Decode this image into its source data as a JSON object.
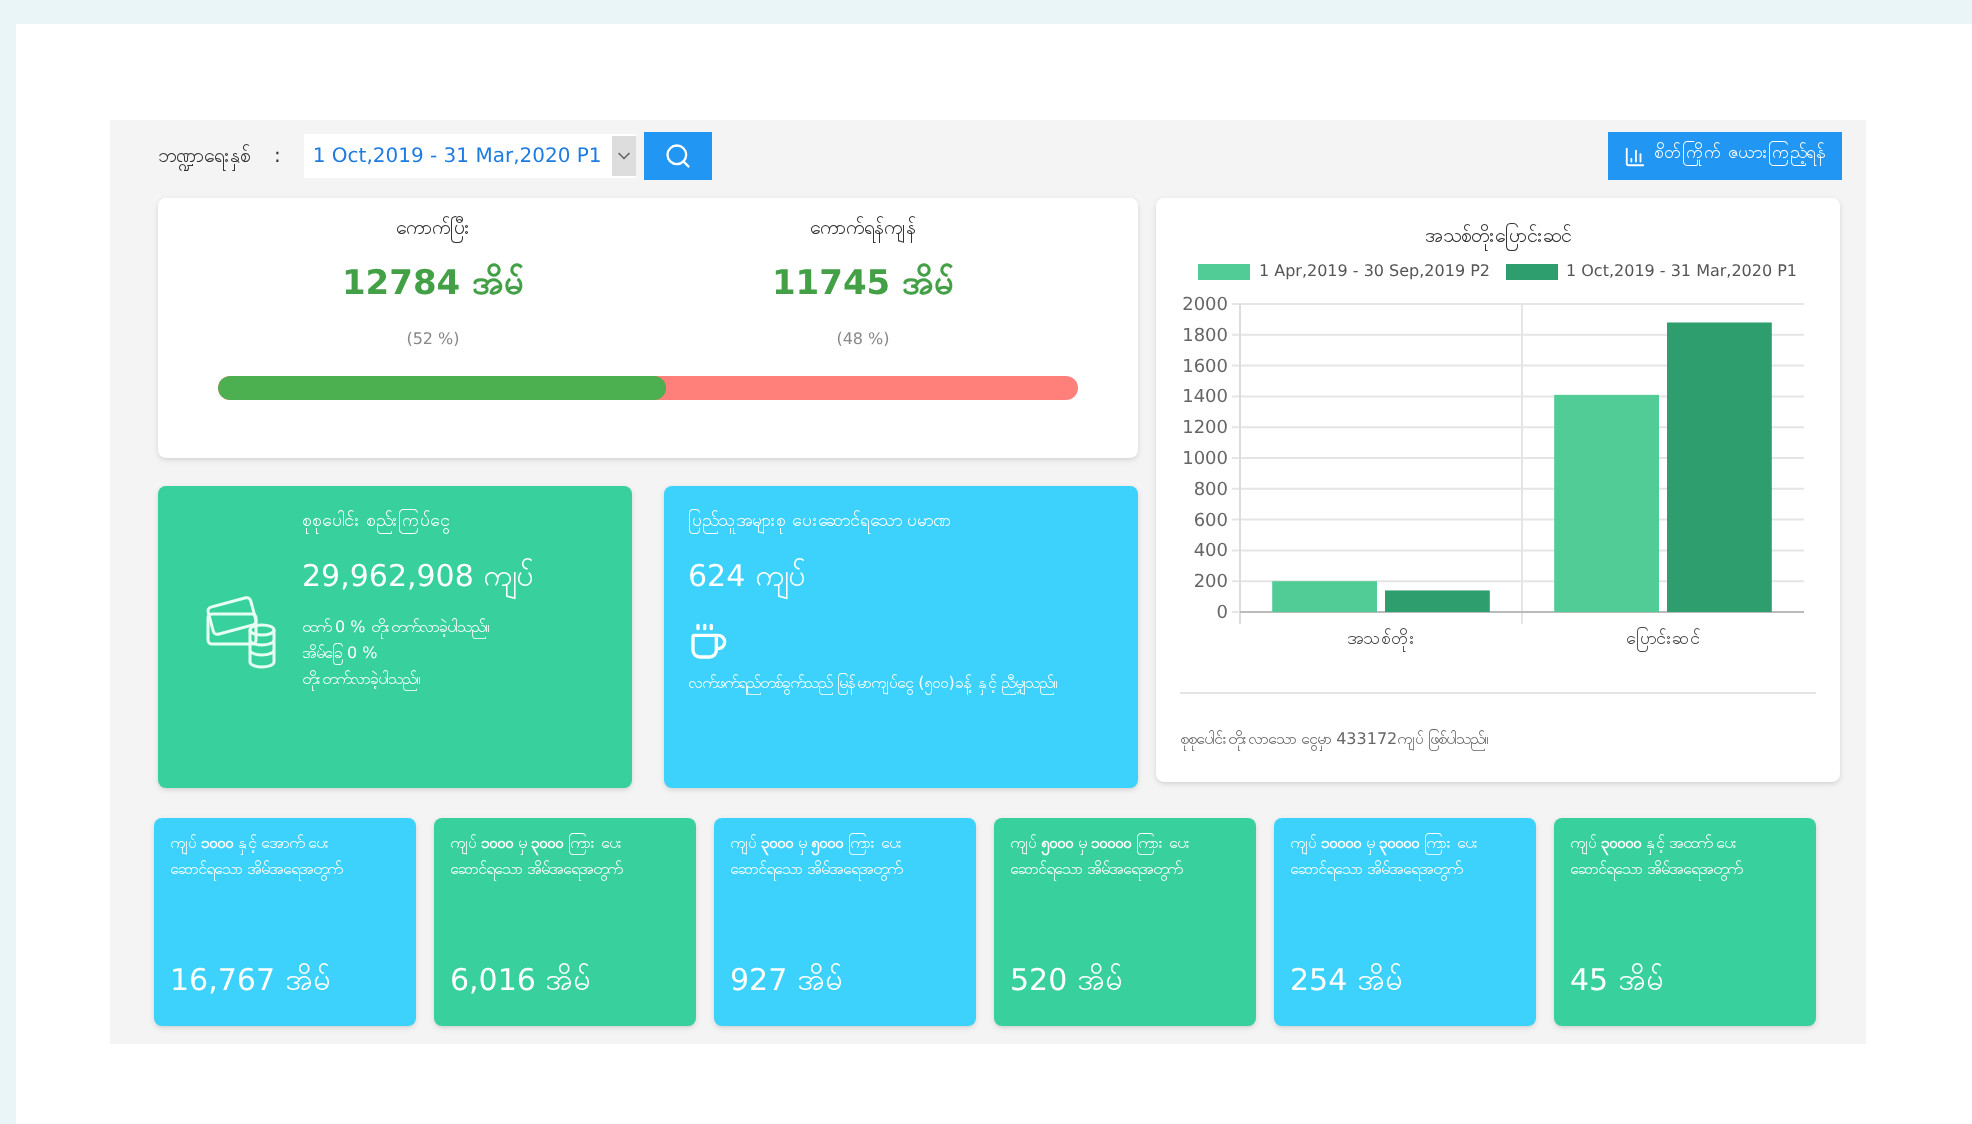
{
  "filter": {
    "label": "ဘဏ္ဍာရေးနှစ်",
    "separator": ":",
    "value": "1 Oct,2019 - 31 Mar,2020 P1"
  },
  "report_button": {
    "label": "စိတ်ကြိုက် ဇယားကြည့်ရန်"
  },
  "collection": {
    "items": [
      {
        "title": "ကောက်ပြီး",
        "value": "12784 အိမ်",
        "percent": "(52 %)"
      },
      {
        "title": "ကောက်ရန်ကျန်",
        "value": "11745 အိမ်",
        "percent": "(48 %)"
      }
    ],
    "level": 0.52
  },
  "total_card": {
    "title": "စုစုပေါင်း စည်းကြပ်ငွေ",
    "value": "29,962,908 ကျပ်",
    "lines": [
      "ထက် 0 % တိုးတက်လာခဲ့ပါသည်။",
      "အိမ်ခြေ 0 %",
      "တိုးတက်လာခဲ့ပါသည်။"
    ]
  },
  "average_card": {
    "title": "ပြည်သူအများစု ပေးဆောင်ရသော ပမာဏ",
    "value": "624 ကျပ်",
    "note": "လက်ဖက်ရည်တစ်ခွက်သည် မြန်မာကျပ်ငွေ (၅၀၀)ခန့် နှင့် ညီမျှသည်။"
  },
  "chart_card": {
    "footer": "စုစုပေါင်းတိုးလာသော ငွေမှာ 433172ကျပ် ဖြစ်ပါသည်။",
    "chart_data": {
      "type": "bar",
      "title": "အသစ်တိုးပြောင်းဆင်",
      "categories": [
        "အသစ်တိုး",
        "ပြောင်းဆင်"
      ],
      "series": [
        {
          "name": "1 Apr,2019 - 30 Sep,2019 P2",
          "color": "#52cc96",
          "values": [
            200,
            1410
          ]
        },
        {
          "name": "1 Oct,2019 - 31 Mar,2020 P1",
          "color": "#2e9e6e",
          "values": [
            140,
            1880
          ]
        }
      ],
      "grid": true,
      "legend": true,
      "ylim": [
        0,
        2000
      ],
      "yticks": [
        0,
        200,
        400,
        600,
        800,
        1000,
        1200,
        1400,
        1600,
        1800,
        2000
      ]
    }
  },
  "range_cards": [
    {
      "title": "ကျပ် **၁၀၀၀** နှင့် အောက် ပေးဆောင်ရသော အိမ်အရေအတွက်",
      "value": "16,767 အိမ်",
      "color": "#3dd2fc"
    },
    {
      "title": "ကျပ် **၁၀၀၀** မှ **၃၀၀၀** ကြား ပေးဆောင်ရသော အိမ်အရေအတွက်",
      "value": "6,016 အိမ်",
      "color": "#38d19e"
    },
    {
      "title": "ကျပ် **၃၀၀၀** မှ **၅၀၀၀** ကြား ပေးဆောင်ရသော အိမ်အရေအတွက်",
      "value": "927 အိမ်",
      "color": "#3dd2fc"
    },
    {
      "title": "ကျပ် **၅၀၀၀** မှ **၁၀၀၀၀** ကြား ပေးဆောင်ရသော အိမ်အရေအတွက်",
      "value": "520 အိမ်",
      "color": "#38d19e"
    },
    {
      "title": "ကျပ် **၁၀၀၀၀** မှ **၃၀၀၀၀** ကြား ပေးဆောင်ရသော အိမ်အရေအတွက်",
      "value": "254 အိမ်",
      "color": "#3dd2fc"
    },
    {
      "title": "ကျပ် **၃၀၀၀၀** နှင့် အထက် ပေးဆောင်ရသော အိမ်အရေအတွက်",
      "value": "45 အိမ်",
      "color": "#38d19e"
    }
  ]
}
